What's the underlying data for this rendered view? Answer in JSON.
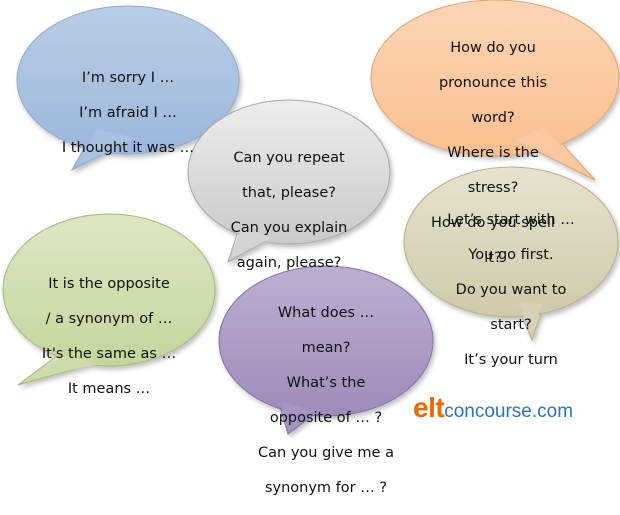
{
  "bubbles": {
    "apology": {
      "color": "#b9cde5",
      "lines": [
        "I’m sorry I …",
        "I’m afraid I …",
        "I thought it was …"
      ]
    },
    "pronunciation": {
      "color": "#fcd5b5",
      "lines": [
        "How do you",
        "pronounce this",
        "word?",
        "Where is the",
        "stress?",
        "How do you spell",
        "it?"
      ]
    },
    "repeat": {
      "color": "#d9d9d9",
      "lines": [
        "Can you repeat",
        "that, please?",
        "Can you explain",
        "again, please?"
      ]
    },
    "turns": {
      "color": "#ddd9c3",
      "lines": [
        "Let’s start with …",
        "You go first.",
        "Do you want to",
        "start?",
        "It’s your turn"
      ]
    },
    "opposite": {
      "color": "#d7e4bd",
      "lines": [
        "It is the opposite",
        "/ a synonym of …",
        "It's the same as …",
        "It means …"
      ]
    },
    "meaning": {
      "color": "#b3a2c7",
      "lines": [
        "What does …",
        "mean?",
        "What’s the",
        "opposite of … ?",
        "Can you give me a",
        "synonym for … ?"
      ]
    }
  },
  "logo": {
    "elt": "elt",
    "rest": "concourse.com"
  }
}
